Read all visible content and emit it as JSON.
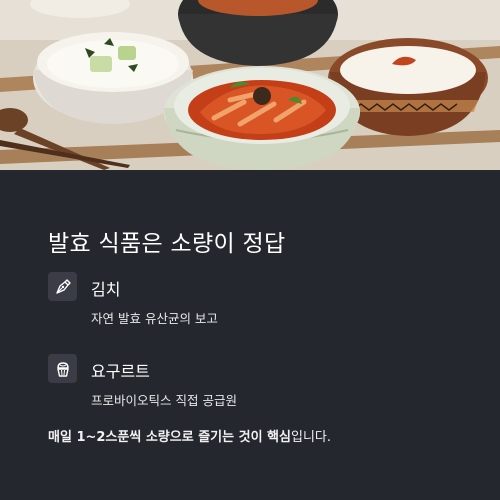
{
  "title": "발효 식품은 소량이 정답",
  "items": [
    {
      "name": "김치",
      "description": "자연 발효 유산균의 보고",
      "icon": "pen-nib-icon"
    },
    {
      "name": "요구르트",
      "description": "프로바이오틱스 직접 공급원",
      "icon": "cupcake-icon"
    }
  ],
  "summary": {
    "bold": "매일 1~2스푼씩 소량으로 즐기는 것이 핵심",
    "rest": "입니다."
  },
  "colors": {
    "background": "#24272e",
    "icon_bg": "#3a3d45",
    "text": "#ffffff"
  },
  "image": {
    "description": "food-photo-fermented-foods"
  }
}
